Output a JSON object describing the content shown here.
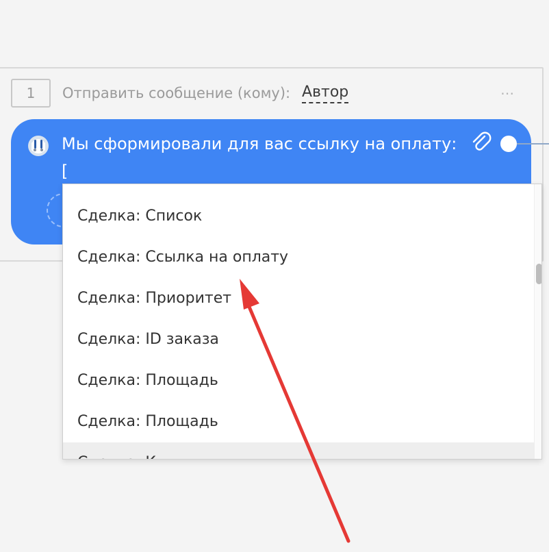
{
  "step": {
    "number": "1",
    "action": "Отправить сообщение  (кому):",
    "target": "Автор"
  },
  "message": {
    "text": "Мы сформировали для вас ссылку на оплату:",
    "cursor": "["
  },
  "dropdown": {
    "items": [
      "Сделка: Список",
      "Сделка: Ссылка на оплату",
      "Сделка: Приоритет",
      "Сделка: ID заказа",
      "Сделка: Площадь",
      "Сделка: Площадь",
      "Сделка: К..."
    ]
  },
  "colors": {
    "bubble": "#3f85f4",
    "arrow": "#e53935"
  }
}
